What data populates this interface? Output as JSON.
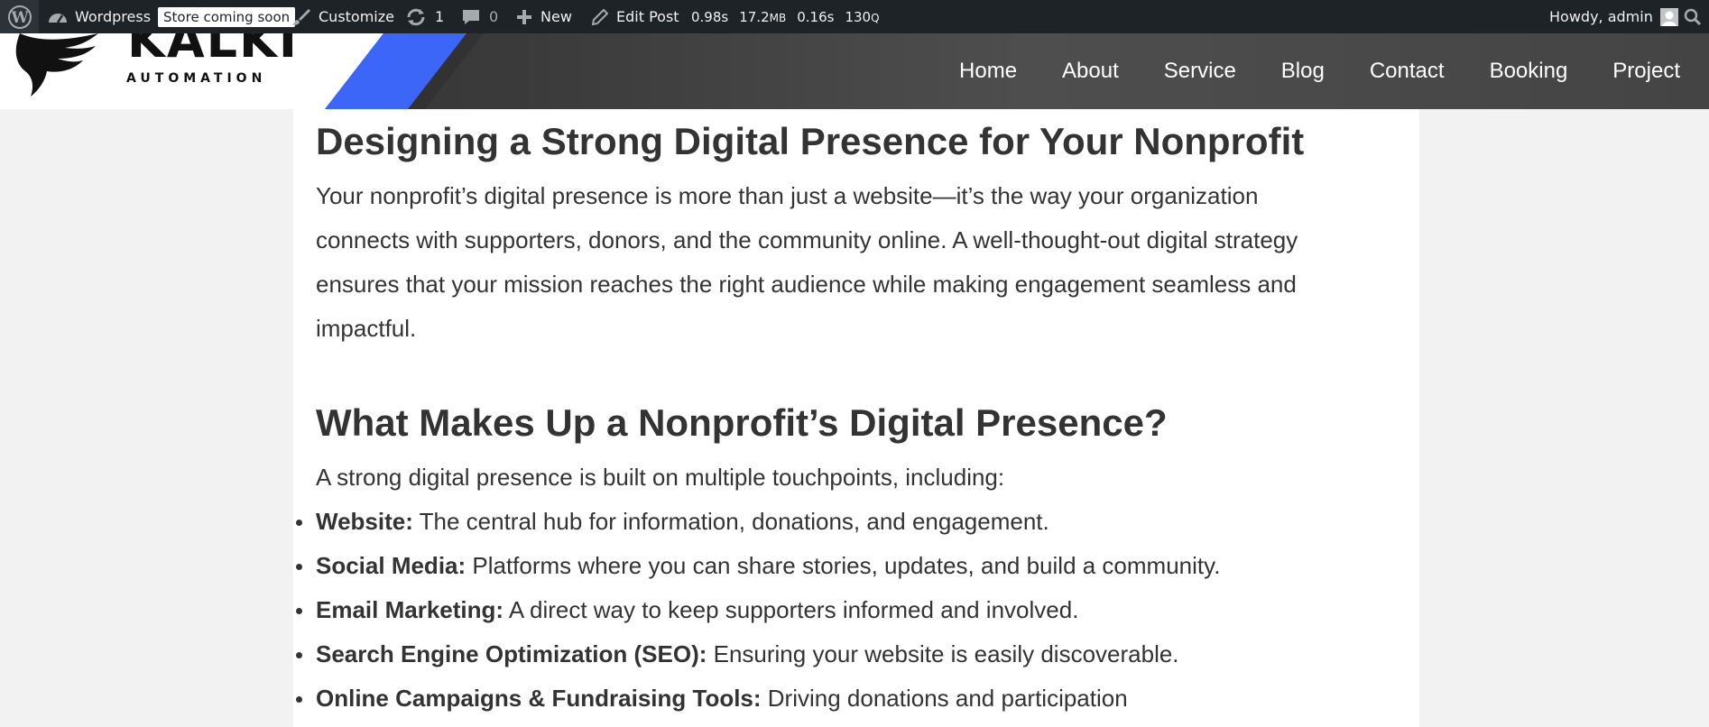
{
  "adminbar": {
    "site_name": "Wordpress",
    "store_badge": "Store coming soon",
    "customize": "Customize",
    "updates_count": "1",
    "comments_count": "0",
    "new_label": "New",
    "edit_post": "Edit Post",
    "qm_time": "0.98s",
    "qm_memory_value": "17.2",
    "qm_memory_unit": "MB",
    "qm_db_time": "0.16s",
    "qm_queries_value": "130",
    "qm_queries_unit": "Q",
    "howdy": "Howdy, admin",
    "icons": [
      "wordpress-logo-icon",
      "dashboard-icon",
      "brush-icon",
      "updates-icon",
      "comment-icon",
      "plus-icon",
      "pencil-icon",
      "avatar-icon",
      "search-icon"
    ]
  },
  "header": {
    "logo_text": "KALKI",
    "logo_subtext": "AUTOMATION",
    "nav": [
      "Home",
      "About",
      "Service",
      "Blog",
      "Contact",
      "Booking",
      "Project"
    ],
    "accent_color": "#3c66f7"
  },
  "article": {
    "heading1": "Designing a Strong Digital Presence for Your Nonprofit",
    "para1": [
      "Your nonprofit’s digital presence is more than just a website—it’s the way your organization",
      "connects with supporters, donors, and the community online. A well-thought-out digital strategy",
      "ensures that your mission reaches the right audience while making engagement seamless and",
      "impactful."
    ],
    "heading2": "What Makes Up a Nonprofit’s Digital Presence?",
    "para2": "A strong digital presence is built on multiple touchpoints, including:",
    "list": [
      {
        "term": "Website:",
        "text": " The central hub for information, donations, and engagement."
      },
      {
        "term": "Social Media:",
        "text": " Platforms where you can share stories, updates, and build a community."
      },
      {
        "term": "Email Marketing:",
        "text": " A direct way to keep supporters informed and involved."
      },
      {
        "term": "Search Engine Optimization (SEO):",
        "text": " Ensuring your website is easily discoverable."
      },
      {
        "term": "Online Campaigns & Fundraising Tools:",
        "text": " Driving donations and participation"
      }
    ]
  }
}
